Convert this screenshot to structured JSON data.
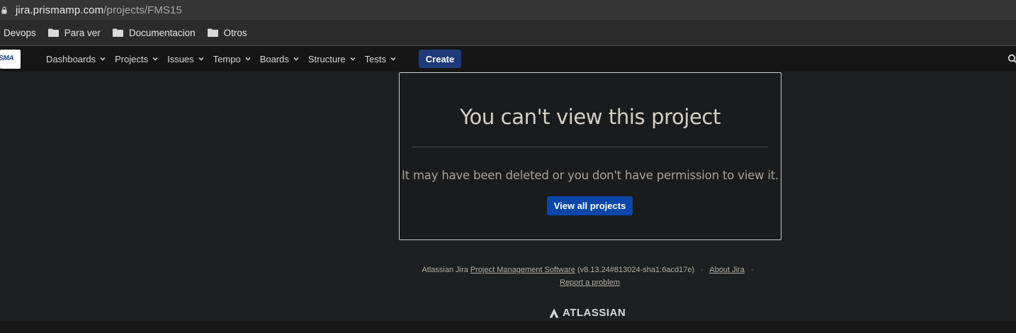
{
  "browser": {
    "url_host": "jira.prismamp.com",
    "url_path": "/projects/FMS15"
  },
  "bookmarks": [
    {
      "label": "Devops",
      "icon": "none"
    },
    {
      "label": "Para ver",
      "icon": "folder-icon"
    },
    {
      "label": "Documentacion",
      "icon": "folder-icon"
    },
    {
      "label": "Otros",
      "icon": "folder-icon"
    }
  ],
  "header": {
    "logo_text": "SMA",
    "nav": [
      {
        "label": "Dashboards"
      },
      {
        "label": "Projects"
      },
      {
        "label": "Issues"
      },
      {
        "label": "Tempo"
      },
      {
        "label": "Boards"
      },
      {
        "label": "Structure"
      },
      {
        "label": "Tests"
      }
    ],
    "create_label": "Create"
  },
  "main": {
    "title": "You can't view this project",
    "message": "It may have been deleted or you don't have permission to view it.",
    "button_label": "View all projects"
  },
  "footer": {
    "prefix": "Atlassian Jira",
    "pms_link": "Project Management Software",
    "version": "(v8.13.24#813024-sha1:6acd17e)",
    "about_link": "About Jira",
    "report_link": "Report a problem",
    "brand": "ATLASSIAN"
  },
  "colors": {
    "create_button": "#1f3a7a",
    "primary_button": "#0b46a8",
    "background": "#1d2021"
  }
}
